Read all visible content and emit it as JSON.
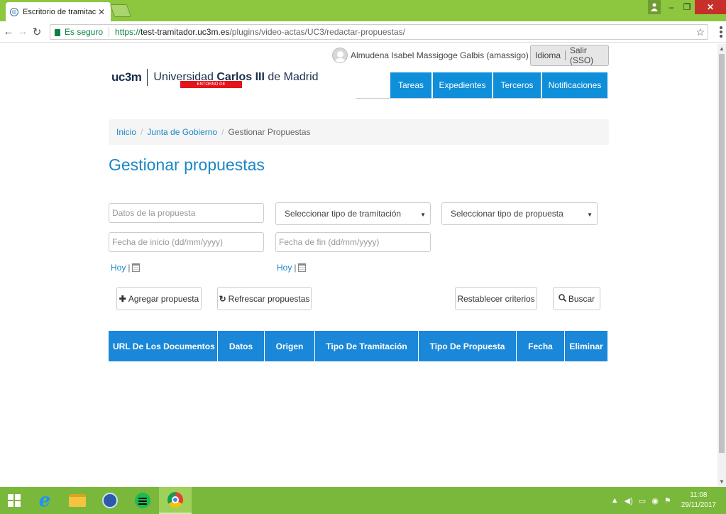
{
  "browser": {
    "tab_title": "Escritorio de tramitación",
    "tab_close": "✕",
    "window_minimize": "–",
    "window_restore": "❐",
    "window_close": "✕",
    "secure_label": "Es seguro",
    "url_scheme": "https://",
    "url_host": "test-tramitador.uc3m.es",
    "url_path": "/plugins/video-actas/UC3/redactar-propuestas/"
  },
  "user": {
    "name": "Almudena Isabel Massigoge Galbis (amassigo)",
    "language_label": "Idioma",
    "logout_label": "Salir (SSO)"
  },
  "logo": {
    "uc3m": "uc3m",
    "univ_prefix": "Universidad ",
    "univ_bold": "Carlos III",
    "univ_suffix": " de Madrid",
    "preprod": "ENTORNO DE PREPRODUCCIÓN"
  },
  "nav": {
    "tareas": "Tareas",
    "expedientes": "Expedientes",
    "terceros": "Terceros",
    "notificaciones": "Notificaciones"
  },
  "breadcrumb": {
    "home": "Inicio",
    "section": "Junta de Gobierno",
    "current": "Gestionar Propuestas",
    "separator": "/"
  },
  "page_title": "Gestionar propuestas",
  "filters": {
    "datos_placeholder": "Datos de la propuesta",
    "tipo_tramitacion": "Seleccionar tipo de tramitación",
    "tipo_propuesta": "Seleccionar tipo de propuesta",
    "fecha_inicio_placeholder": "Fecha de inicio (dd/mm/yyyy)",
    "fecha_fin_placeholder": "Fecha de fin (dd/mm/yyyy)",
    "today_label": "Hoy",
    "pipe": "|"
  },
  "actions": {
    "agregar": "Agregar propuesta",
    "refrescar": "Refrescar propuestas",
    "restablecer": "Restablecer criterios",
    "buscar": "Buscar"
  },
  "table": {
    "columns": [
      "URL De Los Documentos",
      "Datos",
      "Origen",
      "Tipo De Tramitación",
      "Tipo De Propuesta",
      "Fecha",
      "Eliminar"
    ]
  },
  "taskbar": {
    "time": "11:08",
    "date": "29/11/2017"
  },
  "colors": {
    "primary": "#1a87d8",
    "titlebar": "#8dc63f",
    "taskbar": "#7ab83b"
  }
}
